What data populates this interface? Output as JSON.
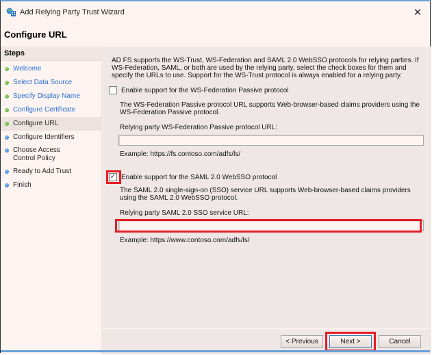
{
  "window": {
    "title": "Add Relying Party Trust Wizard",
    "close_label": "✕"
  },
  "page_title": "Configure URL",
  "steps": {
    "header": "Steps",
    "items": [
      {
        "label": "Welcome",
        "status": "done"
      },
      {
        "label": "Select Data Source",
        "status": "done"
      },
      {
        "label": "Specify Display Name",
        "status": "done"
      },
      {
        "label": "Configure Certificate",
        "status": "done"
      },
      {
        "label": "Configure URL",
        "status": "current"
      },
      {
        "label": "Configure Identifiers",
        "status": "todo"
      },
      {
        "label": "Choose Access Control Policy",
        "status": "todo"
      },
      {
        "label": "Ready to Add Trust",
        "status": "todo"
      },
      {
        "label": "Finish",
        "status": "todo"
      }
    ]
  },
  "intro_text": "AD FS supports the WS-Trust, WS-Federation and SAML 2.0 WebSSO protocols for relying parties.  If WS-Federation, SAML, or both are used by the relying party, select the check boxes for them and specify the URLs to use.  Support for the WS-Trust protocol is always enabled for a relying party.",
  "ws_fed": {
    "checkbox_label": "Enable support for the WS-Federation Passive protocol",
    "checked": false,
    "description": "The WS-Federation Passive protocol URL supports Web-browser-based claims providers using the WS-Federation Passive protocol.",
    "field_label": "Relying party WS-Federation Passive protocol URL:",
    "value": "",
    "example": "Example: https://fs.contoso.com/adfs/ls/"
  },
  "saml": {
    "checkbox_label": "Enable support for the SAML 2.0 WebSSO protocol",
    "checked": true,
    "check_glyph": "✓",
    "description": "The SAML 2.0 single-sign-on (SSO) service URL supports Web-browser-based claims providers using the SAML 2.0 WebSSO protocol.",
    "field_label": "Relying party SAML 2.0 SSO service URL:",
    "value": "",
    "example": "Example: https://www.contoso.com/adfs/ls/"
  },
  "buttons": {
    "previous": "< Previous",
    "next": "Next >",
    "cancel": "Cancel"
  },
  "colors": {
    "highlight": "#e41e26",
    "step_done_dot": "#3f9d22",
    "step_todo_dot": "#1d66c9",
    "link": "#2a6fd6"
  }
}
